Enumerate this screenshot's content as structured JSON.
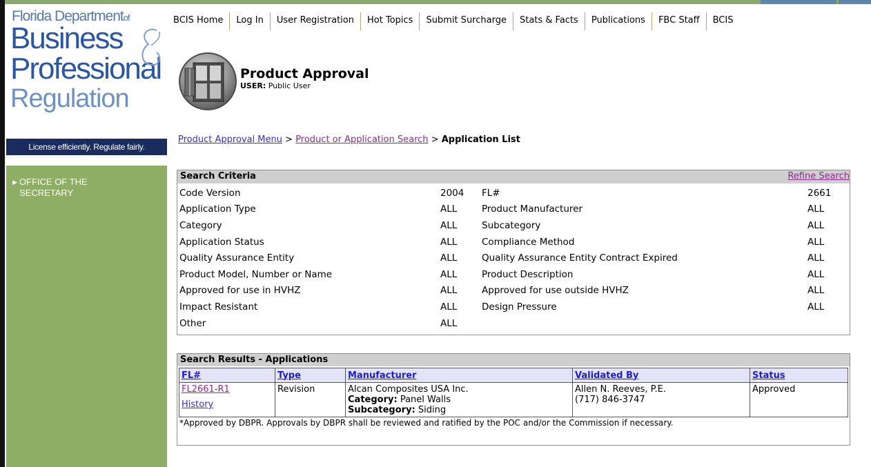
{
  "logo": {
    "line1": "Florida Department",
    "line1_suffix": "of",
    "line2": "Business",
    "line3": "Professional",
    "line4": "Regulation",
    "tagline": "License efficiently. Regulate fairly."
  },
  "sidebar": {
    "items": [
      {
        "label_line1": "OFFICE OF THE",
        "label_line2": "SECRETARY"
      }
    ]
  },
  "topnav": {
    "items": [
      "BCIS Home",
      "Log In",
      "User Registration",
      "Hot Topics",
      "Submit Surcharge",
      "Stats & Facts",
      "Publications",
      "FBC Staff",
      "BCIS"
    ]
  },
  "header": {
    "title": "Product Approval",
    "user_label": "USER:",
    "user_value": "Public User"
  },
  "breadcrumb": {
    "items": [
      "Product Approval Menu",
      "Product or Application Search"
    ],
    "separator": ">",
    "current": "Application List"
  },
  "criteria": {
    "title": "Search Criteria",
    "refine_label": "Refine Search",
    "rows": [
      {
        "l_label": "Code Version",
        "l_value": "2004",
        "r_label": "FL#",
        "r_value": "2661"
      },
      {
        "l_label": "Application Type",
        "l_value": "ALL",
        "r_label": "Product Manufacturer",
        "r_value": "ALL"
      },
      {
        "l_label": "Category",
        "l_value": "ALL",
        "r_label": "Subcategory",
        "r_value": "ALL"
      },
      {
        "l_label": "Application Status",
        "l_value": "ALL",
        "r_label": "Compliance Method",
        "r_value": "ALL"
      },
      {
        "l_label": "Quality Assurance Entity",
        "l_value": "ALL",
        "r_label": "Quality Assurance Entity Contract Expired",
        "r_value": "ALL"
      },
      {
        "l_label": "Product Model, Number or Name",
        "l_value": "ALL",
        "r_label": "Product Description",
        "r_value": "ALL"
      },
      {
        "l_label": "Approved for use in HVHZ",
        "l_value": "ALL",
        "r_label": "Approved for use outside HVHZ",
        "r_value": "ALL"
      },
      {
        "l_label": "Impact Resistant",
        "l_value": "ALL",
        "r_label": "Design Pressure",
        "r_value": "ALL"
      },
      {
        "l_label": "Other",
        "l_value": "ALL",
        "r_label": "",
        "r_value": ""
      }
    ]
  },
  "results": {
    "title": "Search Results - Applications",
    "columns": [
      "FL#",
      "Type",
      "Manufacturer",
      "Validated By",
      "Status"
    ],
    "rows": [
      {
        "fl": "FL2661-R1",
        "history": "History",
        "type": "Revision",
        "manufacturer": "Alcan Composites USA Inc.",
        "category_label": "Category:",
        "category": "Panel Walls",
        "subcategory_label": "Subcategory:",
        "subcategory": "Siding",
        "validator": "Allen N. Reeves, P.E.",
        "validator_phone": "(717) 846-3747",
        "status": "Approved"
      }
    ],
    "footnote": "*Approved by DBPR. Approvals by DBPR shall be reviewed and ratified by the POC and/or the Commission if necessary."
  },
  "colors": {
    "sidebar_green": "#8eae66",
    "tagline_navy": "#1a2c5e",
    "logo_blue": "#2b57a0",
    "link_blue": "#3b2cbe",
    "visited_purple": "#8c2a8c",
    "header_gray": "#cfcfcf"
  }
}
